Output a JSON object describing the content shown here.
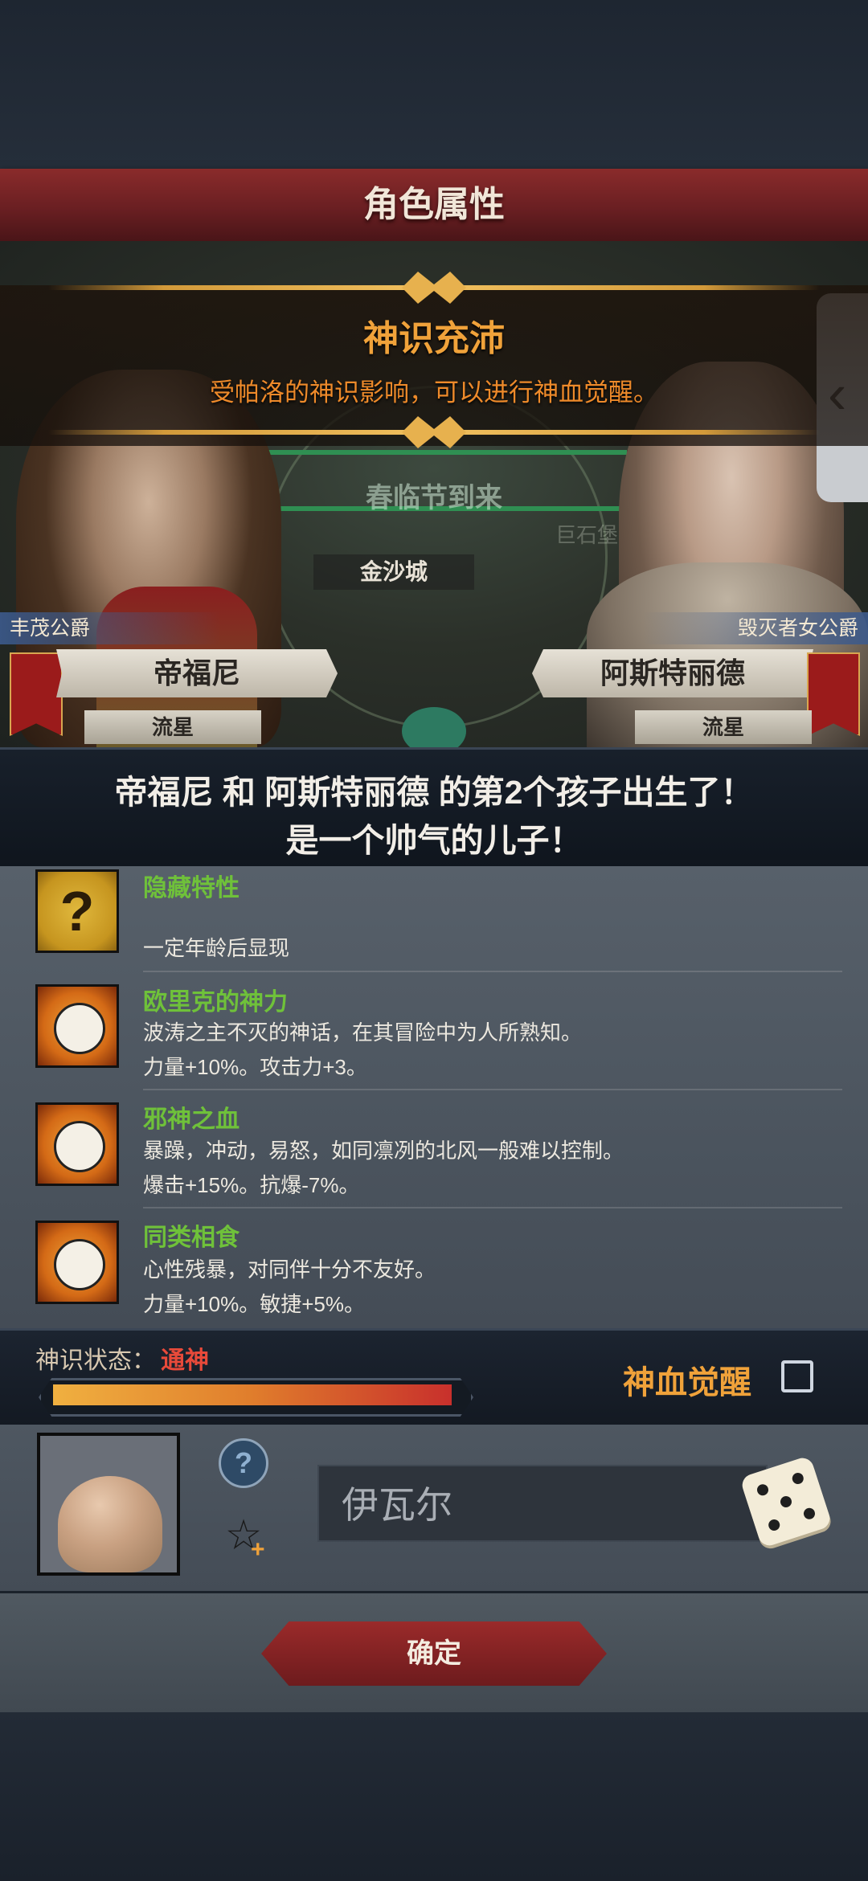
{
  "header": {
    "title": "角色属性"
  },
  "banner": {
    "title": "神识充沛",
    "subtitle": "受帕洛的神识影响，可以进行神血觉醒。"
  },
  "map": {
    "event_label": "春临节到来",
    "city_label": "金沙城",
    "faded_label": "巨石堡"
  },
  "parents": {
    "father": {
      "title": "丰茂公爵",
      "name": "帝福尼",
      "rank": "流星"
    },
    "mother": {
      "title": "毁灭者女公爵",
      "name": "阿斯特丽德",
      "rank": "流星"
    }
  },
  "announcement": {
    "line1": "帝福尼 和 阿斯特丽德 的第2个孩子出生了！",
    "line2": "是一个帅气的儿子！"
  },
  "traits": [
    {
      "icon": "question-icon",
      "name": "隐藏特性",
      "desc1": "",
      "desc2": "一定年龄后显现"
    },
    {
      "icon": "smiley-icon",
      "name": "欧里克的神力",
      "desc1": "波涛之主不灭的神话，在其冒险中为人所熟知。",
      "desc2": "力量+10%。攻击力+3。"
    },
    {
      "icon": "smiley-icon",
      "name": "邪神之血",
      "desc1": "暴躁，冲动，易怒，如同凛冽的北风一般难以控制。",
      "desc2": "爆击+15%。抗爆-7%。"
    },
    {
      "icon": "smiley-icon",
      "name": "同类相食",
      "desc1": "心性残暴，对同伴十分不友好。",
      "desc2": "力量+10%。敏捷+5%。"
    }
  ],
  "status": {
    "label": "神识状态：",
    "value": "通神",
    "progress": 1.0,
    "awaken_label": "神血觉醒",
    "awaken_checked": false
  },
  "child": {
    "name_value": "伊瓦尔",
    "icons": [
      "help-icon",
      "star-plus-icon",
      "dice-icon"
    ]
  },
  "footer": {
    "confirm_label": "确定"
  },
  "colors": {
    "accent_red": "#8a2b2b",
    "trait_green": "#6fc13a",
    "banner_orange": "#f0a23a",
    "status_red": "#e84a3a"
  }
}
